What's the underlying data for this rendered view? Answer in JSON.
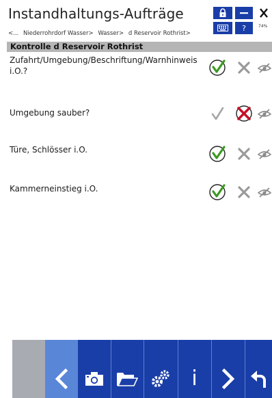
{
  "header": {
    "title": "Instandhaltungs-Aufträge",
    "breadcrumb": [
      "<...",
      "Niederrohrdorf Wasser>",
      "Wasser>",
      "d Reservoir Rothrist>"
    ],
    "help_label": "?",
    "battery": "74%"
  },
  "section": {
    "title": "Kontrolle d Reservoir Rothrist"
  },
  "rows": [
    {
      "label": "Zufahrt/Umgebung/Beschriftung/Warnhinweis i.O.?",
      "state": "ok"
    },
    {
      "label": "Umgebung sauber?",
      "state": "not-ok"
    },
    {
      "label": "Türe, Schlösser i.O.",
      "state": "ok"
    },
    {
      "label": "Kammerneinstieg i.O.",
      "state": "ok"
    }
  ],
  "toolbar": {
    "icons": [
      "back-icon",
      "camera-icon",
      "folder-icon",
      "settings-icon",
      "info-icon",
      "next-icon",
      "undo-icon"
    ],
    "info_label": "i"
  },
  "colors": {
    "accent": "#1a3ea8",
    "ok_green": "#3a9a22",
    "not_ok_red": "#c4122a",
    "section_grey": "#b5b5b5"
  }
}
